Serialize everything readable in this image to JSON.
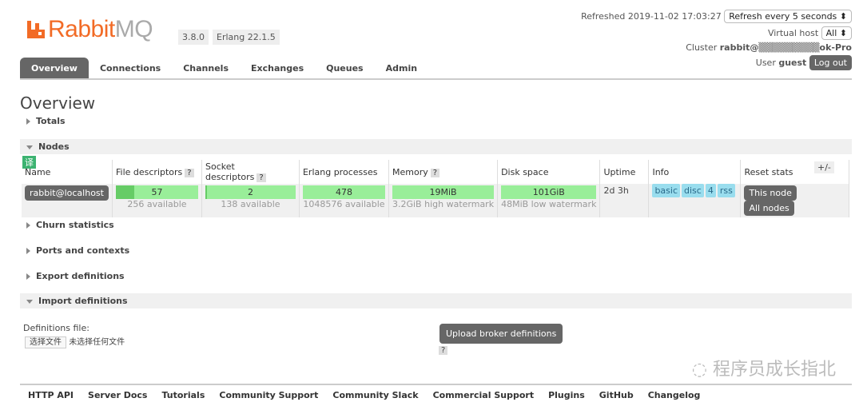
{
  "header": {
    "logo_text_a": "Rabbit",
    "logo_text_b": "MQ",
    "version": "3.8.0",
    "erlang": "Erlang 22.1.5",
    "refreshed_label": "Refreshed 2019-11-02 17:03:27",
    "refresh_select": "Refresh every 5 seconds ⬍",
    "vhost_label": "Virtual host",
    "vhost_select": "All ⬍",
    "cluster_label": "Cluster",
    "cluster_name": "rabbit@▒▒▒▒▒▒▒▒▒ok-Pro",
    "user_label": "User",
    "user_name": "guest",
    "logout": "Log out"
  },
  "tabs": [
    "Overview",
    "Connections",
    "Channels",
    "Exchanges",
    "Queues",
    "Admin"
  ],
  "page_title": "Overview",
  "sections": {
    "totals": "Totals",
    "nodes": "Nodes",
    "churn": "Churn statistics",
    "ports": "Ports and contexts",
    "export": "Export definitions",
    "import": "Import definitions"
  },
  "translate_badge": "译",
  "nodes_table": {
    "headers": [
      "Name",
      "File descriptors",
      "Socket descriptors",
      "Erlang processes",
      "Memory",
      "Disk space",
      "Uptime",
      "Info",
      "Reset stats"
    ],
    "help": "?",
    "plusminus": "+/-",
    "row": {
      "name": "rabbit@localhost",
      "fd": "57",
      "fd_sub": "256 available",
      "fd_fraction": 0.22,
      "sock": "2",
      "sock_sub": "138 available",
      "sock_fraction": 0.015,
      "erl": "478",
      "erl_sub": "1048576 available",
      "mem": "19MiB",
      "mem_sub": "3.2GiB high watermark",
      "disk": "101GiB",
      "disk_sub": "48MiB low watermark",
      "uptime": "2d 3h",
      "info": [
        "basic",
        "disc",
        "4",
        "rss"
      ],
      "reset_this": "This node",
      "reset_all": "All nodes"
    }
  },
  "import": {
    "file_label": "Definitions file:",
    "choose": "选择文件",
    "no_file": "未选择任何文件",
    "upload": "Upload broker definitions",
    "help": "?"
  },
  "watermark": "程序员成长指北",
  "footer": [
    "HTTP API",
    "Server Docs",
    "Tutorials",
    "Community Support",
    "Community Slack",
    "Commercial Support",
    "Plugins",
    "GitHub",
    "Changelog"
  ]
}
